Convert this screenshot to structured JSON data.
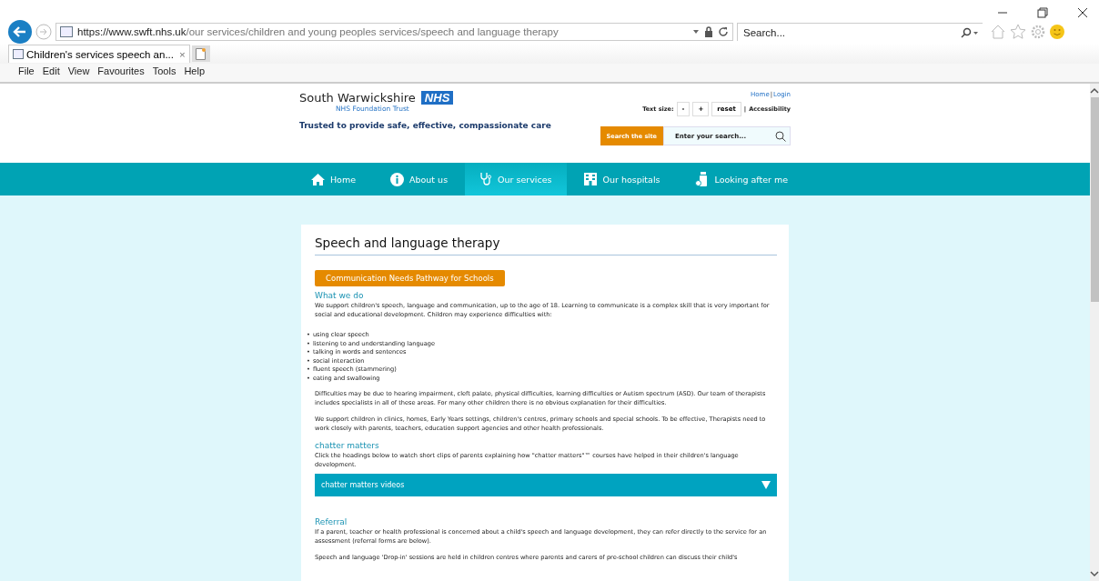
{
  "browser": {
    "url_host": "https://www.swft.nhs.uk",
    "url_path": "/our services/children and young peoples services/speech and language therapy",
    "search_placeholder": "Search...",
    "tab_title": "Children's services speech an...",
    "tab_close": "×",
    "menu": [
      "File",
      "Edit",
      "View",
      "Favourites",
      "Tools",
      "Help"
    ]
  },
  "header": {
    "org_name": "South Warwickshire",
    "badge": "NHS",
    "subtitle": "NHS Foundation Trust",
    "tagline": "Trusted to provide safe, effective, compassionate care",
    "top_links": [
      "Home",
      "Login"
    ],
    "link_separator": "|",
    "accessibility_separator": "|",
    "text_size_label": "Text size:",
    "text_size_buttons": [
      "-",
      "+",
      "reset"
    ],
    "accessibility": "Accessibility",
    "search_label": "Search the site",
    "search_placeholder": "Enter your search..."
  },
  "nav": [
    {
      "label": "Home",
      "selected": false
    },
    {
      "label": "About us",
      "selected": false
    },
    {
      "label": "Our services",
      "selected": true
    },
    {
      "label": "Our hospitals",
      "selected": false
    },
    {
      "label": "Looking after me",
      "selected": false
    }
  ],
  "article": {
    "title": "Speech and language therapy",
    "pathway_button": "Communication Needs Pathway for Schools",
    "blocks": [
      {
        "kind": "heading",
        "text": "What we do"
      },
      {
        "kind": "para",
        "text": "We support children's speech, language and communication, up to the age of 18. Learning to communicate is a complex skill that is very important for social and educational development. Children may experience difficulties with:"
      },
      {
        "kind": "list",
        "bullet": "•",
        "items": [
          "using clear speech",
          "listening to and understanding language",
          "talking in words and sentences",
          "social interaction",
          "fluent speech (stammering)",
          "eating and swallowing"
        ]
      },
      {
        "kind": "para",
        "text": "Difficulties may be due to hearing impairment, cleft palate, physical difficulties, learning difficulties or Autism spectrum (ASD). Our team of therapists includes specialists in all of these areas. For many other children there is no obvious explanation for their difficulties."
      },
      {
        "kind": "para",
        "text": "We support children in clinics, homes, Early Years settings, children's centres, primary schools and special schools. To be effective, Therapists need to work closely with parents, teachers, education support agencies and other health professionals."
      },
      {
        "kind": "heading",
        "text": "chatter matters"
      },
      {
        "kind": "para_tight",
        "text": "Click the headings below to watch short clips of parents explaining how \"chatter matters\"™ courses have helped in their children's language development."
      },
      {
        "kind": "accordion",
        "text": "chatter matters videos",
        "expanded": false
      },
      {
        "kind": "heading",
        "text": "Referral"
      },
      {
        "kind": "para",
        "text": "If a parent, teacher or health professional is concerned about a child's speech and language development, they can refer directly to the service for an assessment (referral forms are below)."
      },
      {
        "kind": "para",
        "text": "Speech and language 'Drop-in' sessions are held in children centres where parents and carers of pre-school children can discuss their child's"
      }
    ]
  }
}
